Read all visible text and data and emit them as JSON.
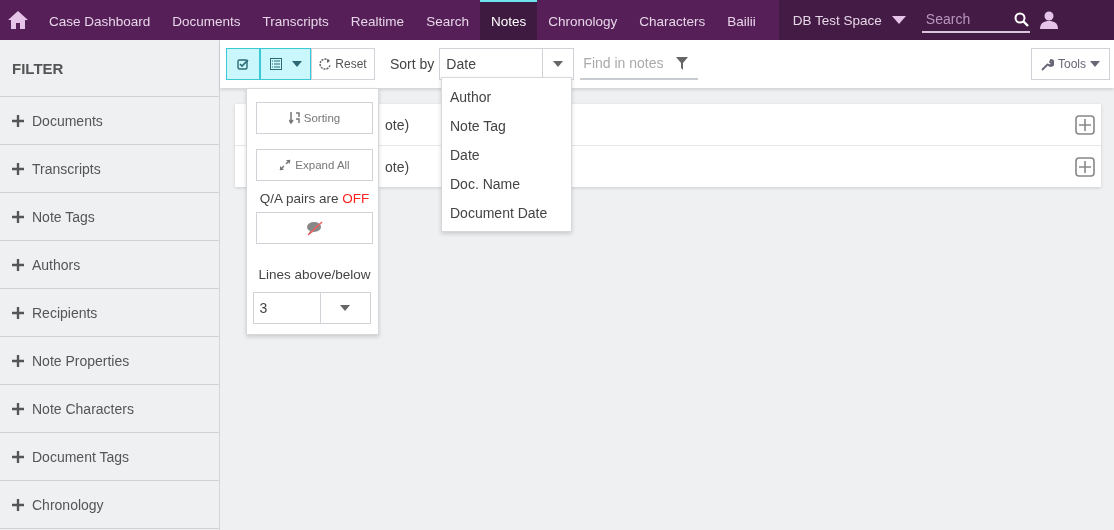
{
  "nav": {
    "items": [
      {
        "label": "Case Dashboard",
        "selected": false
      },
      {
        "label": "Documents",
        "selected": false
      },
      {
        "label": "Transcripts",
        "selected": false
      },
      {
        "label": "Realtime",
        "selected": false
      },
      {
        "label": "Search",
        "selected": false
      },
      {
        "label": "Notes",
        "selected": true
      },
      {
        "label": "Chronology",
        "selected": false
      },
      {
        "label": "Characters",
        "selected": false
      },
      {
        "label": "Bailii",
        "selected": false
      }
    ],
    "workspace": "DB Test Space",
    "search": {
      "placeholder": "Search"
    }
  },
  "sidebar": {
    "title": "FILTER",
    "items": [
      "Documents",
      "Transcripts",
      "Note Tags",
      "Authors",
      "Recipients",
      "Note Properties",
      "Note Characters",
      "Document Tags",
      "Chronology"
    ]
  },
  "toolbar": {
    "select_button": {
      "active": true
    },
    "view_button": {
      "active": true
    },
    "reset_label": "Reset",
    "sort_label": "Sort by",
    "sort_value": "Date",
    "find": {
      "placeholder": "Find in notes"
    },
    "tools_label": "Tools"
  },
  "sort_options": [
    {
      "label": "Author",
      "selected": false
    },
    {
      "label": "Note Tag",
      "selected": false
    },
    {
      "label": "Date",
      "selected": false
    },
    {
      "label": "Doc. Name",
      "selected": false
    },
    {
      "label": "Document Date",
      "selected": false
    }
  ],
  "view_menu": {
    "sorting_label": "Sorting",
    "expand_label": "Expand All",
    "qa_label": "Q/A pairs are",
    "qa_state": "OFF",
    "qa_on": false,
    "lines_label": "Lines above/below",
    "lines_value": "3"
  },
  "notes": [
    "ote)",
    "ote)"
  ]
}
